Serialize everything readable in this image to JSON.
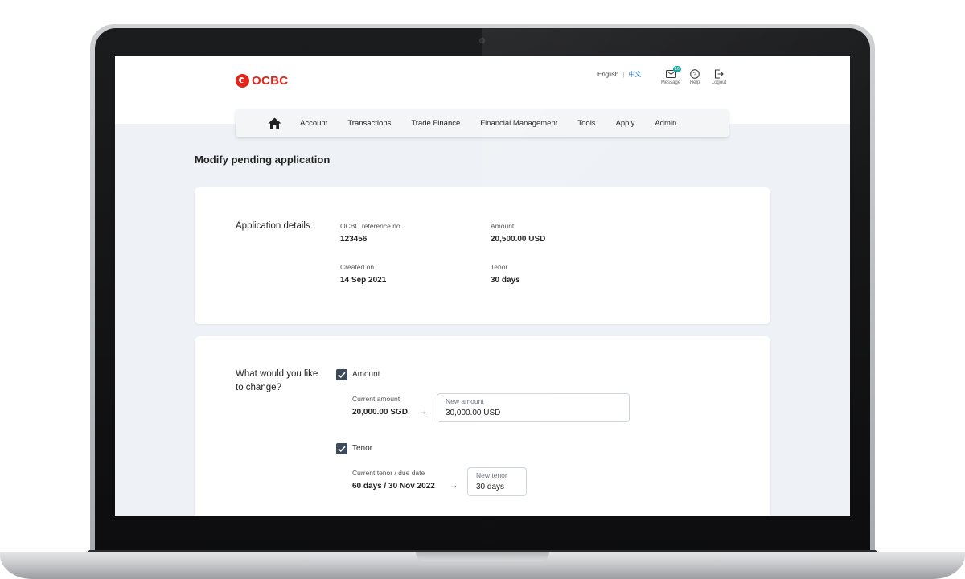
{
  "brand": {
    "logo_text": "OCBC",
    "accent_color": "#e1251b"
  },
  "header": {
    "languages": {
      "english": "English",
      "chinese": "中文"
    },
    "icons": [
      {
        "name": "message-icon",
        "label": "Message",
        "badge": "10"
      },
      {
        "name": "help-icon",
        "label": "Help"
      },
      {
        "name": "logout-icon",
        "label": "Logout"
      }
    ]
  },
  "nav": {
    "home_icon": "home-icon",
    "items": [
      "Account",
      "Transactions",
      "Trade Finance",
      "Financial Management",
      "Tools",
      "Apply",
      "Admin"
    ]
  },
  "page": {
    "title": "Modify pending application"
  },
  "application_details": {
    "section_title": "Application details",
    "reference_label": "OCBC reference no.",
    "reference_value": "123456",
    "amount_label": "Amount",
    "amount_value": "20,500.00 USD",
    "created_label": "Created on",
    "created_value": "14 Sep 2021",
    "tenor_label": "Tenor",
    "tenor_value": "30 days"
  },
  "change": {
    "section_title_line1": "What would you like",
    "section_title_line2": "to change?",
    "amount": {
      "checkbox_label": "Amount",
      "checked": true,
      "current_label": "Current amount",
      "current_value": "20,000.00 SGD",
      "new_label": "New amount",
      "new_value": "30,000.00 USD"
    },
    "tenor": {
      "checkbox_label": "Tenor",
      "checked": true,
      "current_label": "Current tenor / due date",
      "current_value": "60 days / 30 Nov 2022",
      "new_label": "New tenor",
      "new_value": "30 days"
    },
    "arrow": "→"
  }
}
